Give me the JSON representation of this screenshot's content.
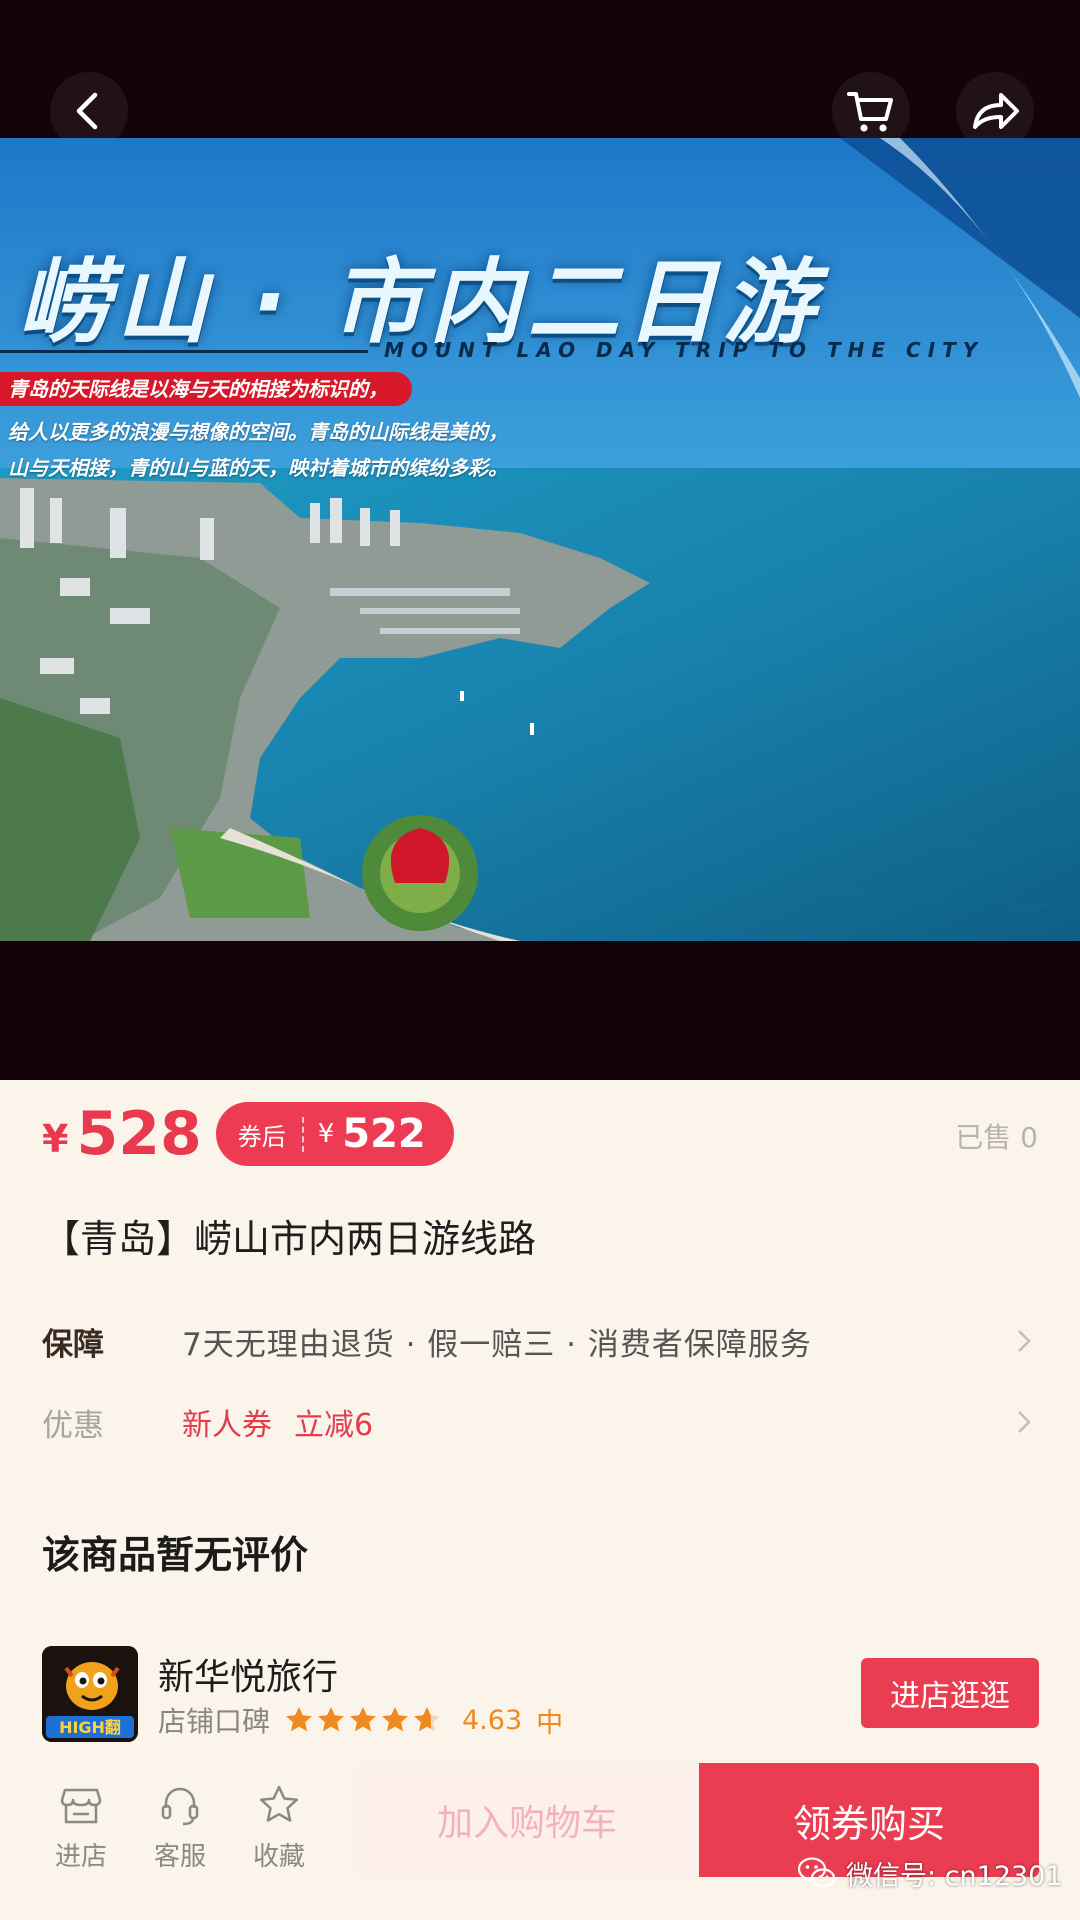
{
  "hero": {
    "title": "崂山 · 市内二日游",
    "subtitle": "MOUNT LAO DAY TRIP TO THE CITY",
    "tag": "青岛的天际线是以海与天的相接为标识的，",
    "desc_line1": "给人以更多的浪漫与想像的空间。青岛的山际线是美的，",
    "desc_line2": "山与天相接，青的山与蓝的天，映衬着城市的缤纷多彩。"
  },
  "price": {
    "currency": "¥",
    "value": "528",
    "coupon_label": "券后",
    "coupon_value": "522",
    "sold": "已售 0"
  },
  "product": {
    "title": "【青岛】崂山市内两日游线路"
  },
  "guarantee": {
    "label": "保障",
    "value": "7天无理由退货 · 假一赔三 · 消费者保障服务"
  },
  "promo": {
    "label": "优惠",
    "tags": [
      "新人券",
      "立减6"
    ]
  },
  "reviews": {
    "title": "该商品暂无评价"
  },
  "shop": {
    "name": "新华悦旅行",
    "rating_label": "店铺口碑",
    "stars": 4.63,
    "score": "4.63",
    "level": "中",
    "enter_label": "进店逛逛",
    "logo_text": "HIGH翻"
  },
  "bottom": {
    "tabs": [
      {
        "label": "进店",
        "icon": "store-icon"
      },
      {
        "label": "客服",
        "icon": "headset-icon"
      },
      {
        "label": "收藏",
        "icon": "star-icon"
      }
    ],
    "add_cart": "加入购物车",
    "buy": "领券购买"
  },
  "watermark": "微信号: cn12301",
  "colors": {
    "accent": "#ea3d52",
    "price": "#e8394f",
    "rating": "#ef8a1e",
    "background": "#fbf4ea"
  }
}
